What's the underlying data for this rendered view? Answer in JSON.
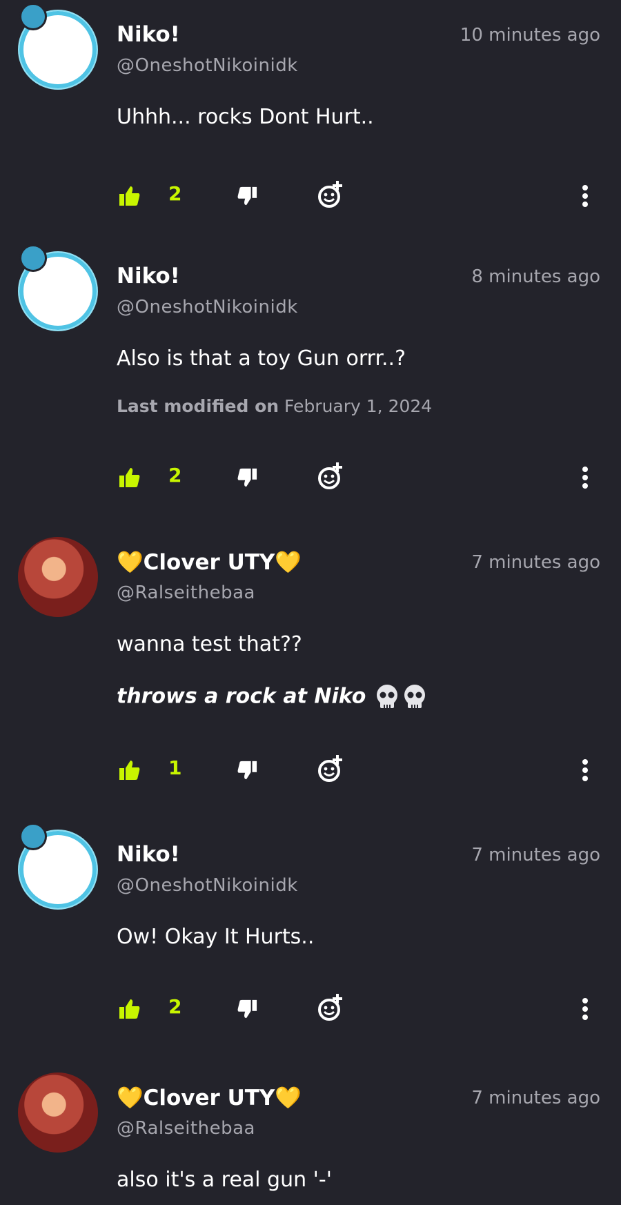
{
  "comments": [
    {
      "name": "Niko!",
      "handle": "@OneshotNikoinidk",
      "time": "10 minutes ago",
      "text": "Uhhh... rocks Dont Hurt..",
      "likes": "2"
    },
    {
      "name": "Niko!",
      "handle": "@OneshotNikoinidk",
      "time": "8 minutes ago",
      "text": "Also is that a toy Gun orrr..?",
      "modified_label": "Last modified on",
      "modified_date": "February 1, 2024",
      "likes": "2"
    },
    {
      "name": "Clover UTY",
      "name_prefix": "💛",
      "name_suffix": "💛",
      "handle": "@Ralseithebaa",
      "time": "7 minutes ago",
      "text": "wanna test that??",
      "text2": "throws a rock at Niko",
      "likes": "1"
    },
    {
      "name": "Niko!",
      "handle": "@OneshotNikoinidk",
      "time": "7 minutes ago",
      "text": "Ow! Okay It Hurts..",
      "likes": "2"
    },
    {
      "name": "Clover UTY",
      "name_prefix": "💛",
      "name_suffix": "💛",
      "handle": "@Ralseithebaa",
      "time": "7 minutes ago",
      "text": "also it's a real gun '-'"
    }
  ],
  "colors": {
    "background": "#23232b",
    "accent_like": "#c8f500",
    "muted_text": "#a7a7af",
    "heart": "#f5b91d"
  },
  "icons": [
    "thumbs-up-icon",
    "thumbs-down-icon",
    "add-reaction-icon",
    "more-options-icon",
    "skull-icon"
  ]
}
